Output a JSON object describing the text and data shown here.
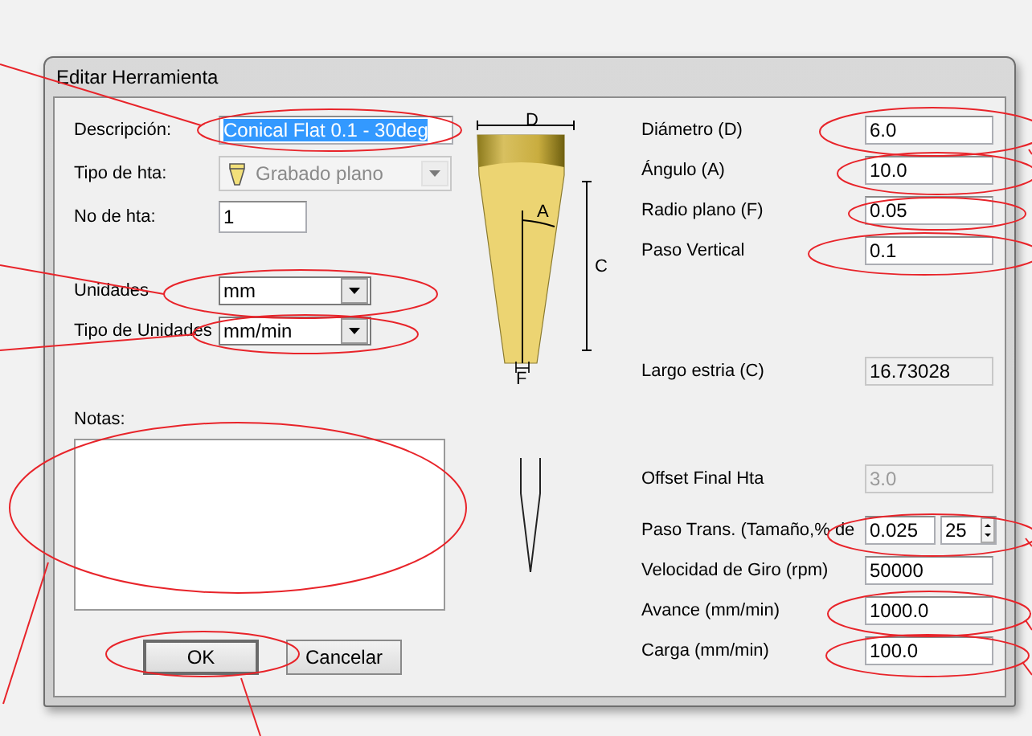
{
  "window": {
    "title": "Editar Herramienta"
  },
  "left_sections": [
    {
      "fields": [
        {
          "label": "Descripción:",
          "kind": "text",
          "value": "Conical Flat 0.1 - 30deg",
          "value_selected": true,
          "disabled": false
        },
        {
          "label": "Tipo de hta:",
          "kind": "tool-combo",
          "value": "Grabado plano",
          "disabled": true
        },
        {
          "label": "No de hta:",
          "kind": "short-text",
          "value": "1",
          "disabled": false
        }
      ]
    },
    {
      "fields": [
        {
          "label": "Unidades",
          "kind": "dropdown",
          "value": "mm",
          "disabled": false
        },
        {
          "label": "Tipo de Unidades",
          "kind": "dropdown",
          "value": "mm/min",
          "disabled": false
        }
      ]
    }
  ],
  "notes": {
    "label": "Notas:"
  },
  "diagram": {
    "diameter_label": "D",
    "angle_label": "A",
    "length_label": "C",
    "flat_label": "F"
  },
  "right_sections": [
    {
      "fields": [
        {
          "label": "Diámetro (D)",
          "kind": "text",
          "value": "6.0",
          "disabled": false
        },
        {
          "label": "Ángulo (A)",
          "kind": "text",
          "value": "10.0",
          "disabled": false
        },
        {
          "label": "Radio plano (F)",
          "kind": "text",
          "value": "0.05",
          "disabled": false
        },
        {
          "label": "Paso Vertical",
          "kind": "text",
          "value": "0.1",
          "disabled": false
        }
      ]
    },
    {
      "fields": [
        {
          "label": "Largo estria (C)",
          "kind": "readout",
          "value": "16.73028",
          "disabled": false
        }
      ]
    },
    {
      "fields": [
        {
          "label": "Offset Final Hta",
          "kind": "text",
          "value": "3.0",
          "disabled": true
        }
      ]
    },
    {
      "fields": [
        {
          "label": "Paso Trans. (Tamaño,% de",
          "kind": "spinner",
          "value": "0.025",
          "percent": "25",
          "disabled": false
        },
        {
          "label": "Velocidad de Giro (rpm)",
          "kind": "text",
          "value": "50000",
          "disabled": false
        },
        {
          "label": "Avance (mm/min)",
          "kind": "text",
          "value": "1000.0",
          "disabled": false
        },
        {
          "label": "Carga (mm/min)",
          "kind": "text",
          "value": "100.0",
          "disabled": false
        }
      ]
    }
  ],
  "buttons": [
    {
      "label": "OK",
      "default": true
    },
    {
      "label": "Cancelar",
      "default": false
    }
  ]
}
